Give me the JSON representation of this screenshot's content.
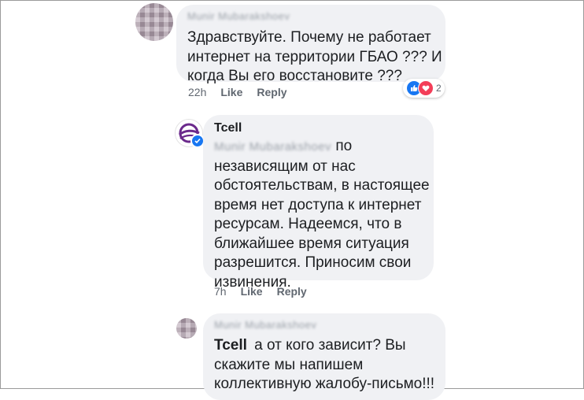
{
  "comment1": {
    "author": "Munir Mubarakshoev",
    "text_lines": [
      "Здравствуйте. Почему не работает",
      "интернет на территории ГБАО ??? И",
      "когда Вы его восстановите ???"
    ],
    "time": "22h",
    "like_label": "Like",
    "reply_label": "Reply",
    "reaction_count": "2"
  },
  "comment2": {
    "author": "Tcell",
    "mention": "Munir Mubarakshoev",
    "text_first": "по",
    "text_lines": [
      "независящим от нас",
      "обстоятельствам, в настоящее",
      "время нет доступа к интернет",
      "ресурсам. Надеемся, что в",
      "ближайшее время ситуация",
      "разрешится. Приносим свои",
      "извинения."
    ],
    "time": "7h",
    "like_label": "Like",
    "reply_label": "Reply"
  },
  "comment3": {
    "author": "Munir Mubarakshoev",
    "mention": "Tcell",
    "text_first": "а от кого зависит? Вы",
    "text_lines": [
      "скажите мы напишем",
      "коллективную жалобу-письмо!!!"
    ]
  },
  "colors": {
    "bubble": "#f0f1f4",
    "like": "#1877f2",
    "love": "#f33e58",
    "tcell_purple": "#6b2a8c"
  }
}
